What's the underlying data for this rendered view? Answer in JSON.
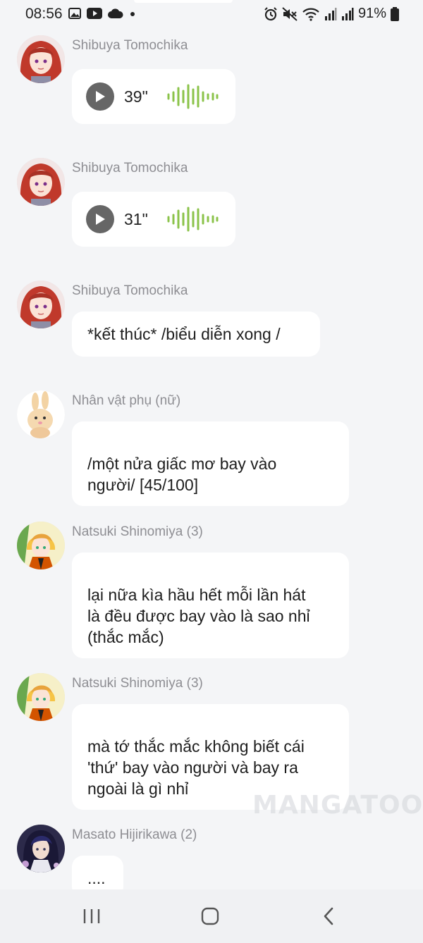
{
  "status_bar": {
    "time": "08:56",
    "left_icons": [
      "image-icon",
      "youtube-icon",
      "cloud-icon",
      "dot-icon"
    ],
    "right_icons": [
      "alarm-icon",
      "mute-icon",
      "wifi-icon",
      "signal-icon",
      "signal-icon-2",
      "battery-icon"
    ],
    "battery": "91%"
  },
  "messages": [
    {
      "sender": "Shibuya Tomochika",
      "type": "voice",
      "duration": "39\"",
      "avatar": "red-hair-avatar"
    },
    {
      "sender": "Shibuya Tomochika",
      "type": "voice",
      "duration": "31\"",
      "avatar": "red-hair-avatar"
    },
    {
      "sender": "Shibuya Tomochika",
      "type": "text",
      "text": "*kết thúc* /biểu diễn xong /",
      "avatar": "red-hair-avatar"
    },
    {
      "sender": "Nhân vật phụ (nữ)",
      "type": "text",
      "text": "/một nửa giấc mơ bay vào\nngười/ [45/100]",
      "avatar": "bunny-avatar"
    },
    {
      "sender": "Natsuki Shinomiya (3)",
      "type": "text",
      "text": "lại nữa kìa hầu hết mỗi lần hát\nlà đều được bay vào là sao nhỉ\n(thắc mắc)",
      "avatar": "blonde-avatar"
    },
    {
      "sender": "Natsuki Shinomiya (3)",
      "type": "text",
      "text": "mà tớ thắc mắc không biết cái\n'thứ' bay vào người và bay ra\nngoài là gì nhỉ",
      "avatar": "blonde-avatar"
    },
    {
      "sender": "Masato Hijirikawa (2)",
      "type": "text",
      "text": "....",
      "avatar": "dark-hair-avatar"
    }
  ],
  "watermark": "MANGATOON",
  "colors": {
    "background": "#f4f5f7",
    "bubble": "#ffffff",
    "sender_text": "#8e8e93",
    "waveform": "#8bc34a",
    "play_button": "#666666"
  },
  "nav_bar": {
    "buttons": [
      "recent-apps-icon",
      "home-icon",
      "back-icon"
    ]
  }
}
